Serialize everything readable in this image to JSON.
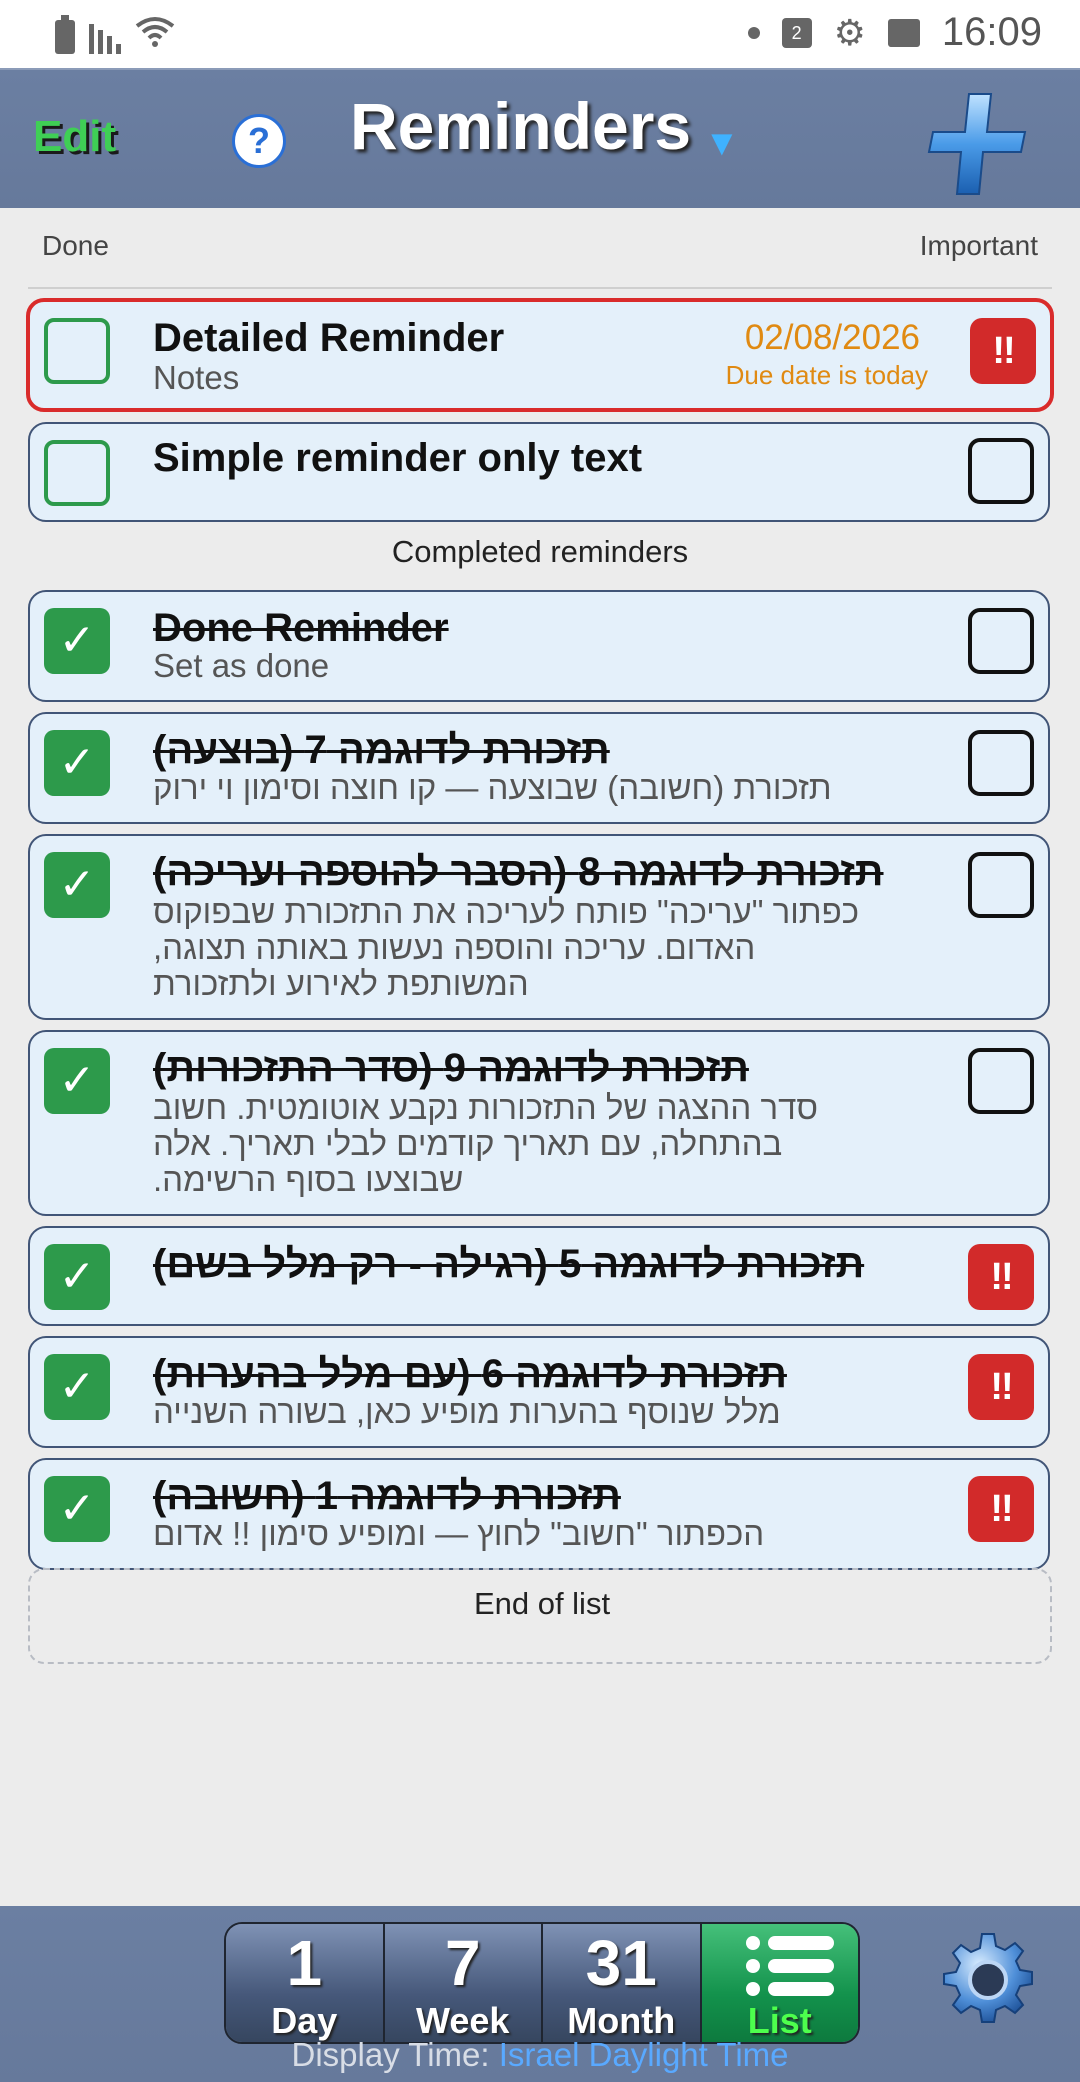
{
  "status_bar": {
    "time": "16:09",
    "calendar_badge": "2",
    "icons": [
      "battery-icon",
      "signal-icon",
      "wifi-icon",
      "notification-dot-icon",
      "calendar-icon",
      "gear-icon",
      "image-icon"
    ]
  },
  "header": {
    "edit_label": "Edit",
    "help_label": "?",
    "title": "Reminders",
    "title_caret": "▼",
    "add_icon": "plus-icon"
  },
  "columns": {
    "done": "Done",
    "important": "Important"
  },
  "active_reminders": [
    {
      "title": "Detailed Reminder",
      "notes": "Notes",
      "due_date": "02/08/2026",
      "due_note": "Due date is today",
      "important": true,
      "important_label": "!!"
    },
    {
      "title": "Simple reminder only text",
      "important": false
    }
  ],
  "completed_label": "Completed reminders",
  "completed_reminders": [
    {
      "title": "Done Reminder",
      "notes": "Set as done",
      "important": false
    },
    {
      "title": "תזכורת לדוגמה 7 (בוצעה)",
      "notes": "תזכורת (חשובה) שבוצעה — קו חוצה וסימון וי ירוק",
      "important": false
    },
    {
      "title": "תזכורת לדוגמה 8 (הסבר להוספה ועריכה)",
      "notes_lines": [
        "כפתור \"עריכה\" פותח לעריכה את התזכורת שבפוקוס",
        "האדום. עריכה והוספה נעשות באותה תצוגה,",
        "המשותפת לאירוע ולתזכורת"
      ],
      "important": false
    },
    {
      "title": "תזכורת לדוגמה 9 (סדר התזכורות)",
      "notes_lines": [
        "סדר ההצגה של התזכורות נקבע אוטומטית. חשוב",
        "בהתחלה, עם תאריך קודמים לבלי תאריך. אלה",
        "שבוצעו בסוף הרשימה."
      ],
      "important": false
    },
    {
      "title": "תזכורת לדוגמה 5 (רגילה - רק מלל בשם)",
      "important": true
    },
    {
      "title": "תזכורת לדוגמה 6 (עם מלל בהערות)",
      "notes": "מלל שנוסף בהערות מופיע כאן, בשורה השנייה",
      "important": true
    },
    {
      "title": "תזכורת לדוגמה 1 (חשובה)",
      "notes": "הכפתור \"חשוב\" לחוץ — ומופיע סימון !! אדום",
      "important": true
    }
  ],
  "check_mark": "✓",
  "end_of_list": "End of list",
  "bottom_nav": {
    "tabs": [
      {
        "number": "1",
        "label": "Day"
      },
      {
        "number": "7",
        "label": "Week"
      },
      {
        "number": "31",
        "label": "Month"
      },
      {
        "label": "List",
        "icon": "list-icon",
        "active": true
      }
    ],
    "settings_icon": "gear-icon",
    "display_time_prefix": "Display Time:",
    "display_time_zone": "Israel Daylight Time"
  },
  "colors": {
    "header_bg": "#6b7fa2",
    "card_bg": "#e4f0fa",
    "done_green": "#2d9a4b",
    "important_red": "#d22a2a",
    "due_orange": "#e08a12",
    "focus_border": "#d92b2b",
    "active_tab": "#13924c"
  }
}
